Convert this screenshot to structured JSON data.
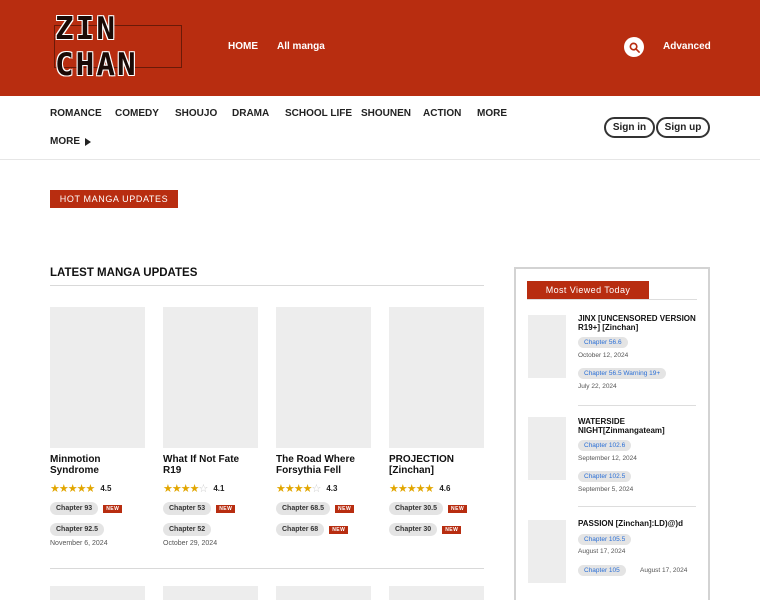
{
  "header": {
    "logo_text": "ZIN CHAN",
    "nav": [
      "HOME",
      "All manga"
    ],
    "advanced": "Advanced"
  },
  "genres": [
    "ROMANCE",
    "COMEDY",
    "SHOUJO",
    "DRAMA",
    "SCHOOL LIFE",
    "SHOUNEN",
    "ACTION",
    "MORE"
  ],
  "more2": "MORE",
  "auth": {
    "signin": "Sign in",
    "signup": "Sign up"
  },
  "hot_label": "HOT MANGA UPDATES",
  "latest_title": "LATEST MANGA UPDATES",
  "cards": [
    {
      "title": "Minmotion Syndrome",
      "rating": 4.5,
      "rating_text": "4.5",
      "ch1": "Chapter 93",
      "ch1_new": "NEW",
      "ch2": "Chapter 92.5",
      "date": "November 6, 2024"
    },
    {
      "title": "What If Not Fate R19",
      "rating": 4.1,
      "rating_text": "4.1",
      "ch1": "Chapter 53",
      "ch1_new": "NEW",
      "ch2": "Chapter 52",
      "date": "October 29, 2024"
    },
    {
      "title": "The Road Where Forsythia Fell",
      "rating": 4.3,
      "rating_text": "4.3",
      "ch1": "Chapter 68.5",
      "ch1_new": "NEW",
      "ch2": "Chapter 68",
      "ch2_new": "NEW",
      "date": ""
    },
    {
      "title": "PROJECTION [Zinchan]",
      "rating": 4.6,
      "rating_text": "4.6",
      "ch1": "Chapter 30.5",
      "ch1_new": "NEW",
      "ch2": "Chapter 30",
      "ch2_new": "NEW",
      "date": ""
    }
  ],
  "most_viewed": {
    "label": "Most Viewed Today",
    "items": [
      {
        "title": "JINX [UNCENSORED VERSION R19+] [Zinchan]",
        "ch1": "Chapter 56.6",
        "date1": "October 12, 2024",
        "ch2": "Chapter 56.5 Warning 19+",
        "date2": "July 22, 2024"
      },
      {
        "title": "WATERSIDE NIGHT[Zinmangateam]",
        "ch1": "Chapter 102.6",
        "date1": "September 12, 2024",
        "ch2": "Chapter 102.5",
        "date2": "September 5, 2024"
      },
      {
        "title": "PASSION [Zinchan]:LD)@)d",
        "ch1": "Chapter 105.5",
        "date1": "August 17, 2024",
        "ch2": "Chapter 105",
        "date2": "August 17, 2024"
      }
    ]
  },
  "colors": {
    "brand": "#b82d10",
    "star": "#e2a600",
    "link": "#2a6fd6"
  }
}
